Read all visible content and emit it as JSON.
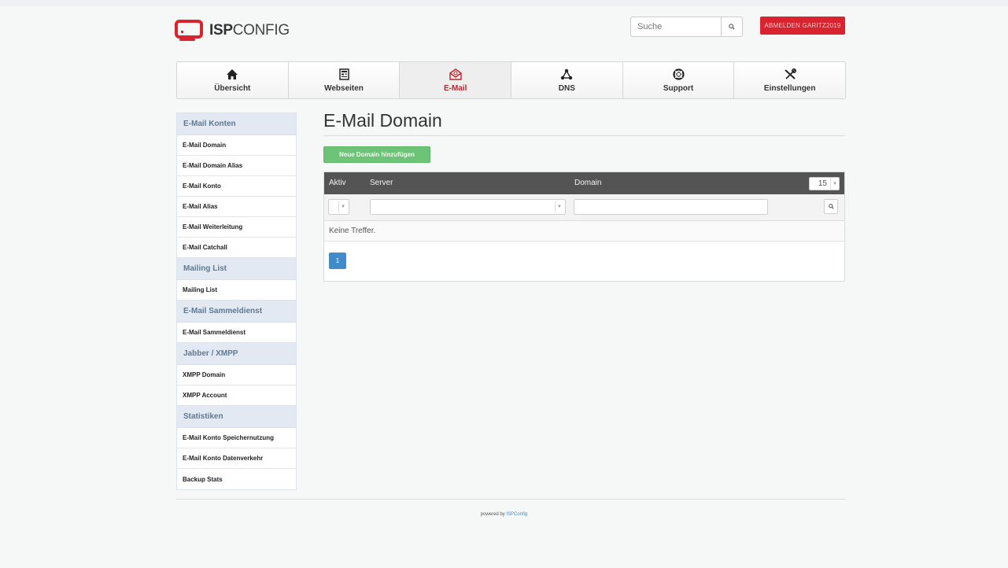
{
  "brand": {
    "logo_bold": "ISP",
    "logo_light": "CONFIG",
    "accent": "#d9232e"
  },
  "header": {
    "search_placeholder": "Suche",
    "logout_label": "ABMELDEN GARITZ2019"
  },
  "nav": {
    "items": [
      {
        "label": "Übersicht",
        "icon": "home-icon"
      },
      {
        "label": "Webseiten",
        "icon": "website-icon"
      },
      {
        "label": "E-Mail",
        "icon": "email-icon",
        "active": true
      },
      {
        "label": "DNS",
        "icon": "dns-icon"
      },
      {
        "label": "Support",
        "icon": "lifebuoy-icon"
      },
      {
        "label": "Einstellungen",
        "icon": "tools-icon"
      }
    ]
  },
  "sidebar": {
    "sections": [
      {
        "title": "E-Mail Konten",
        "items": [
          "E-Mail Domain",
          "E-Mail Domain Alias",
          "E-Mail Konto",
          "E-Mail Alias",
          "E-Mail Weiterleitung",
          "E-Mail Catchall"
        ]
      },
      {
        "title": "Mailing List",
        "items": [
          "Mailing List"
        ]
      },
      {
        "title": "E-Mail Sammeldienst",
        "items": [
          "E-Mail Sammeldienst"
        ]
      },
      {
        "title": "Jabber / XMPP",
        "items": [
          "XMPP Domain",
          "XMPP Account"
        ]
      },
      {
        "title": "Statistiken",
        "items": [
          "E-Mail Konto Speichernutzung",
          "E-Mail Konto Datenverkehr",
          "Backup Stats"
        ]
      }
    ]
  },
  "main": {
    "title": "E-Mail Domain",
    "add_button": "Neue Domain hinzufügen",
    "table": {
      "col_active": "Aktiv",
      "col_server": "Server",
      "col_domain": "Domain",
      "page_size": "15",
      "empty_text": "Keine Treffer.",
      "current_page": "1"
    }
  },
  "footer": {
    "prefix": "powered by",
    "link": "ISPConfig"
  }
}
